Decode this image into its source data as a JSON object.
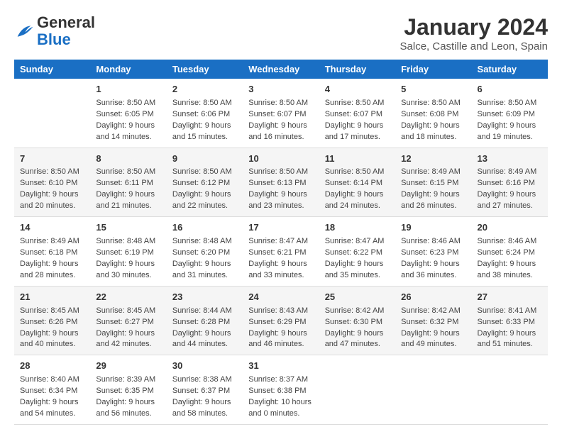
{
  "header": {
    "logo_text_general": "General",
    "logo_text_blue": "Blue",
    "month_title": "January 2024",
    "location": "Salce, Castille and Leon, Spain"
  },
  "weekdays": [
    "Sunday",
    "Monday",
    "Tuesday",
    "Wednesday",
    "Thursday",
    "Friday",
    "Saturday"
  ],
  "weeks": [
    [
      {
        "day": "",
        "sunrise": "",
        "sunset": "",
        "daylight": ""
      },
      {
        "day": "1",
        "sunrise": "Sunrise: 8:50 AM",
        "sunset": "Sunset: 6:05 PM",
        "daylight": "Daylight: 9 hours and 14 minutes."
      },
      {
        "day": "2",
        "sunrise": "Sunrise: 8:50 AM",
        "sunset": "Sunset: 6:06 PM",
        "daylight": "Daylight: 9 hours and 15 minutes."
      },
      {
        "day": "3",
        "sunrise": "Sunrise: 8:50 AM",
        "sunset": "Sunset: 6:07 PM",
        "daylight": "Daylight: 9 hours and 16 minutes."
      },
      {
        "day": "4",
        "sunrise": "Sunrise: 8:50 AM",
        "sunset": "Sunset: 6:07 PM",
        "daylight": "Daylight: 9 hours and 17 minutes."
      },
      {
        "day": "5",
        "sunrise": "Sunrise: 8:50 AM",
        "sunset": "Sunset: 6:08 PM",
        "daylight": "Daylight: 9 hours and 18 minutes."
      },
      {
        "day": "6",
        "sunrise": "Sunrise: 8:50 AM",
        "sunset": "Sunset: 6:09 PM",
        "daylight": "Daylight: 9 hours and 19 minutes."
      }
    ],
    [
      {
        "day": "7",
        "sunrise": "Sunrise: 8:50 AM",
        "sunset": "Sunset: 6:10 PM",
        "daylight": "Daylight: 9 hours and 20 minutes."
      },
      {
        "day": "8",
        "sunrise": "Sunrise: 8:50 AM",
        "sunset": "Sunset: 6:11 PM",
        "daylight": "Daylight: 9 hours and 21 minutes."
      },
      {
        "day": "9",
        "sunrise": "Sunrise: 8:50 AM",
        "sunset": "Sunset: 6:12 PM",
        "daylight": "Daylight: 9 hours and 22 minutes."
      },
      {
        "day": "10",
        "sunrise": "Sunrise: 8:50 AM",
        "sunset": "Sunset: 6:13 PM",
        "daylight": "Daylight: 9 hours and 23 minutes."
      },
      {
        "day": "11",
        "sunrise": "Sunrise: 8:50 AM",
        "sunset": "Sunset: 6:14 PM",
        "daylight": "Daylight: 9 hours and 24 minutes."
      },
      {
        "day": "12",
        "sunrise": "Sunrise: 8:49 AM",
        "sunset": "Sunset: 6:15 PM",
        "daylight": "Daylight: 9 hours and 26 minutes."
      },
      {
        "day": "13",
        "sunrise": "Sunrise: 8:49 AM",
        "sunset": "Sunset: 6:16 PM",
        "daylight": "Daylight: 9 hours and 27 minutes."
      }
    ],
    [
      {
        "day": "14",
        "sunrise": "Sunrise: 8:49 AM",
        "sunset": "Sunset: 6:18 PM",
        "daylight": "Daylight: 9 hours and 28 minutes."
      },
      {
        "day": "15",
        "sunrise": "Sunrise: 8:48 AM",
        "sunset": "Sunset: 6:19 PM",
        "daylight": "Daylight: 9 hours and 30 minutes."
      },
      {
        "day": "16",
        "sunrise": "Sunrise: 8:48 AM",
        "sunset": "Sunset: 6:20 PM",
        "daylight": "Daylight: 9 hours and 31 minutes."
      },
      {
        "day": "17",
        "sunrise": "Sunrise: 8:47 AM",
        "sunset": "Sunset: 6:21 PM",
        "daylight": "Daylight: 9 hours and 33 minutes."
      },
      {
        "day": "18",
        "sunrise": "Sunrise: 8:47 AM",
        "sunset": "Sunset: 6:22 PM",
        "daylight": "Daylight: 9 hours and 35 minutes."
      },
      {
        "day": "19",
        "sunrise": "Sunrise: 8:46 AM",
        "sunset": "Sunset: 6:23 PM",
        "daylight": "Daylight: 9 hours and 36 minutes."
      },
      {
        "day": "20",
        "sunrise": "Sunrise: 8:46 AM",
        "sunset": "Sunset: 6:24 PM",
        "daylight": "Daylight: 9 hours and 38 minutes."
      }
    ],
    [
      {
        "day": "21",
        "sunrise": "Sunrise: 8:45 AM",
        "sunset": "Sunset: 6:26 PM",
        "daylight": "Daylight: 9 hours and 40 minutes."
      },
      {
        "day": "22",
        "sunrise": "Sunrise: 8:45 AM",
        "sunset": "Sunset: 6:27 PM",
        "daylight": "Daylight: 9 hours and 42 minutes."
      },
      {
        "day": "23",
        "sunrise": "Sunrise: 8:44 AM",
        "sunset": "Sunset: 6:28 PM",
        "daylight": "Daylight: 9 hours and 44 minutes."
      },
      {
        "day": "24",
        "sunrise": "Sunrise: 8:43 AM",
        "sunset": "Sunset: 6:29 PM",
        "daylight": "Daylight: 9 hours and 46 minutes."
      },
      {
        "day": "25",
        "sunrise": "Sunrise: 8:42 AM",
        "sunset": "Sunset: 6:30 PM",
        "daylight": "Daylight: 9 hours and 47 minutes."
      },
      {
        "day": "26",
        "sunrise": "Sunrise: 8:42 AM",
        "sunset": "Sunset: 6:32 PM",
        "daylight": "Daylight: 9 hours and 49 minutes."
      },
      {
        "day": "27",
        "sunrise": "Sunrise: 8:41 AM",
        "sunset": "Sunset: 6:33 PM",
        "daylight": "Daylight: 9 hours and 51 minutes."
      }
    ],
    [
      {
        "day": "28",
        "sunrise": "Sunrise: 8:40 AM",
        "sunset": "Sunset: 6:34 PM",
        "daylight": "Daylight: 9 hours and 54 minutes."
      },
      {
        "day": "29",
        "sunrise": "Sunrise: 8:39 AM",
        "sunset": "Sunset: 6:35 PM",
        "daylight": "Daylight: 9 hours and 56 minutes."
      },
      {
        "day": "30",
        "sunrise": "Sunrise: 8:38 AM",
        "sunset": "Sunset: 6:37 PM",
        "daylight": "Daylight: 9 hours and 58 minutes."
      },
      {
        "day": "31",
        "sunrise": "Sunrise: 8:37 AM",
        "sunset": "Sunset: 6:38 PM",
        "daylight": "Daylight: 10 hours and 0 minutes."
      },
      {
        "day": "",
        "sunrise": "",
        "sunset": "",
        "daylight": ""
      },
      {
        "day": "",
        "sunrise": "",
        "sunset": "",
        "daylight": ""
      },
      {
        "day": "",
        "sunrise": "",
        "sunset": "",
        "daylight": ""
      }
    ]
  ]
}
